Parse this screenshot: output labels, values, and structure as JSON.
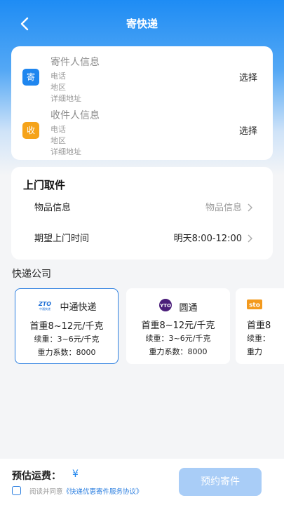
{
  "header": {
    "title": "寄快递"
  },
  "sender": {
    "badge": "寄",
    "title": "寄件人信息",
    "phone": "电话",
    "region": "地区",
    "address": "详细地址",
    "action": "选择"
  },
  "receiver": {
    "badge": "收",
    "title": "收件人信息",
    "phone": "电话",
    "region": "地区",
    "address": "详细地址",
    "action": "选择"
  },
  "pickup": {
    "title": "上门取件",
    "goods_label": "物品信息",
    "goods_value": "物品信息",
    "time_label": "期望上门时间",
    "time_value": "明天8:00-12:00"
  },
  "carriers_title": "快递公司",
  "carriers": [
    {
      "name": "中通快递",
      "logo": "zto-logo",
      "logo_text": "ZTO",
      "logo_sub": "中通快递",
      "price_main": "首重8~12元/千克",
      "price_sub": "续重：3~6元/千克",
      "coef": "重力系数：8000",
      "selected": true
    },
    {
      "name": "圆通",
      "logo": "yto-logo",
      "logo_text": "YTO",
      "price_main": "首重8~12元/千克",
      "price_sub": "续重：3~6元/千克",
      "coef": "重力系数：8000",
      "selected": false
    },
    {
      "name": "",
      "logo": "sto-logo",
      "logo_text": "sto",
      "price_main": "首重8",
      "price_sub": "续重：",
      "coef": "重力",
      "selected": false
    }
  ],
  "footer": {
    "fee_label": "预估运费：",
    "fee_symbol": "¥",
    "agree_prefix": "阅读并同意",
    "agree_link": "《快递优惠寄件服务协议》",
    "submit": "预约寄件"
  },
  "colors": {
    "primary": "#1f86ef",
    "sender_badge": "#1f86ef",
    "receiver_badge": "#f5a31a",
    "button_disabled": "#a9cdf7"
  }
}
